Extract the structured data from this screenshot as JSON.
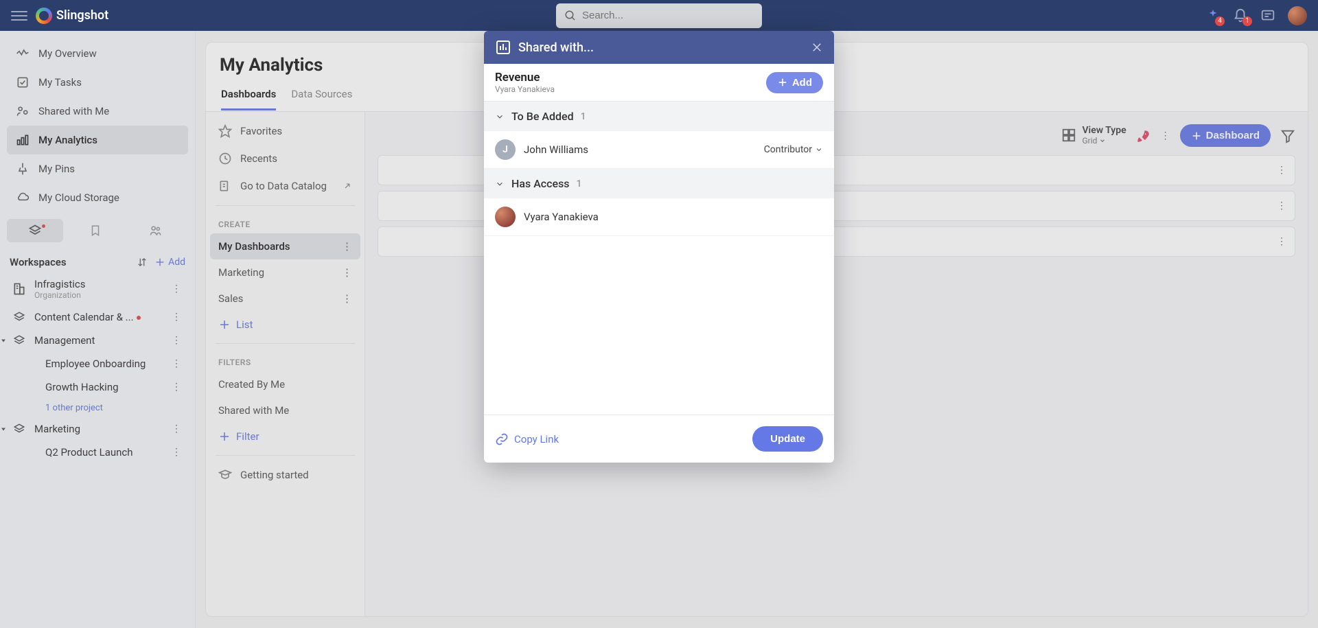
{
  "app": {
    "name": "Slingshot"
  },
  "search": {
    "placeholder": "Search..."
  },
  "topbar": {
    "ai_badge": "4",
    "bell_badge": "1"
  },
  "nav": {
    "items": [
      {
        "label": "My Overview"
      },
      {
        "label": "My Tasks"
      },
      {
        "label": "Shared with Me"
      },
      {
        "label": "My Analytics"
      },
      {
        "label": "My Pins"
      },
      {
        "label": "My Cloud Storage"
      }
    ]
  },
  "workspaces": {
    "title": "Workspaces",
    "add_label": "Add",
    "items": {
      "infragistics": {
        "name": "Infragistics",
        "subtitle": "Organization"
      },
      "content_calendar": {
        "name": "Content Calendar & ..."
      },
      "management": {
        "name": "Management"
      },
      "employee": {
        "name": "Employee Onboarding"
      },
      "growth": {
        "name": "Growth Hacking"
      },
      "other": "1 other project",
      "marketing": {
        "name": "Marketing"
      },
      "q2": {
        "name": "Q2 Product Launch"
      }
    }
  },
  "panel": {
    "title": "My Analytics",
    "tabs": {
      "dashboards": "Dashboards",
      "data_sources": "Data Sources"
    }
  },
  "secondary": {
    "favorites": "Favorites",
    "recents": "Recents",
    "data_catalog": "Go to Data Catalog",
    "create_header": "CREATE",
    "my_dashboards": "My Dashboards",
    "marketing": "Marketing",
    "sales": "Sales",
    "add_list": "List",
    "filters_header": "FILTERS",
    "created_by_me": "Created By Me",
    "shared_with_me": "Shared with Me",
    "add_filter": "Filter",
    "getting_started": "Getting started"
  },
  "toolbar": {
    "view_type_label": "View Type",
    "view_type_value": "Grid",
    "dashboard_btn": "Dashboard"
  },
  "modal": {
    "title": "Shared with...",
    "item_title": "Revenue",
    "item_owner": "Vyara Yanakieva",
    "add_btn": "Add",
    "section_to_be_added": "To Be Added",
    "section_to_be_added_count": "1",
    "section_has_access": "Has Access",
    "section_has_access_count": "1",
    "to_add": [
      {
        "name": "John Williams",
        "initial": "J",
        "role": "Contributor",
        "avatar_bg": "#a7aebb"
      }
    ],
    "has_access": [
      {
        "name": "Vyara Yanakieva",
        "avatar_bg": "#7a2a2a"
      }
    ],
    "copy_link": "Copy Link",
    "update_btn": "Update"
  }
}
